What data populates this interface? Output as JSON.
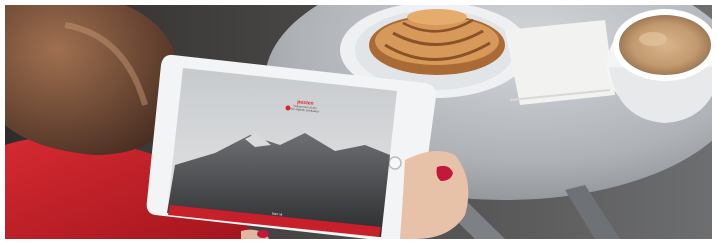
{
  "tablet_screen": {
    "logo_text": "posten",
    "welcome_line_1": "Velkommen til din",
    "welcome_line_2": "nye digitale postkasse",
    "button_label": "Start nå"
  },
  "colors": {
    "brand_red": "#d9262c",
    "sweater_red": "#c8202a",
    "table_top": "#b9bdc2",
    "coffee_foam": "#c9a27a",
    "pastry": "#c98c52"
  }
}
